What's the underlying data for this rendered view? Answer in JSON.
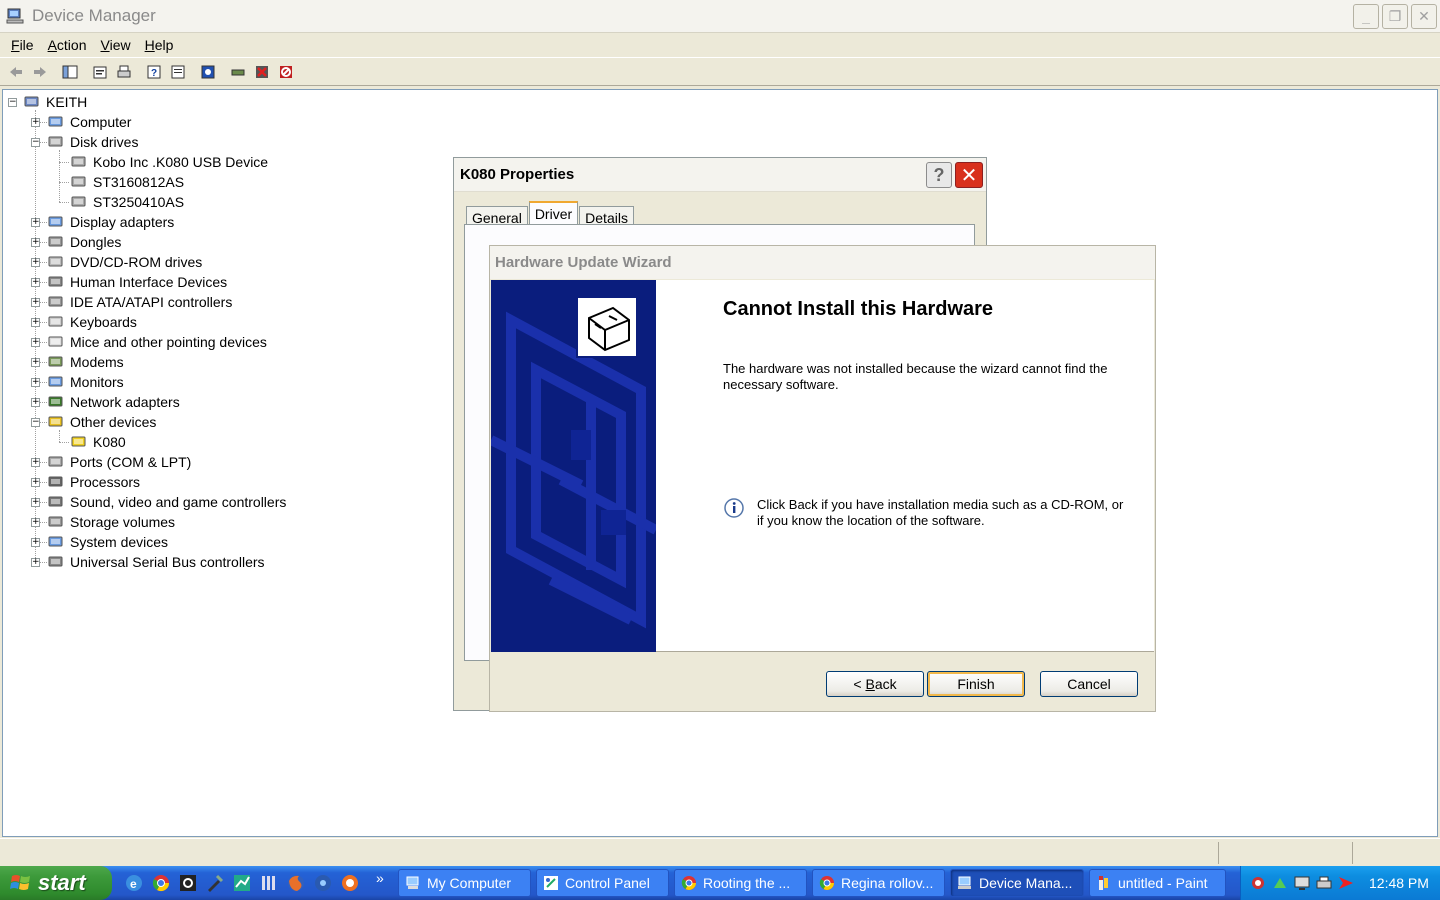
{
  "window": {
    "title": "Device Manager"
  },
  "menu": [
    {
      "label": "File",
      "key": "F",
      "rest": "ile"
    },
    {
      "label": "Action",
      "key": "A",
      "rest": "ction"
    },
    {
      "label": "View",
      "key": "V",
      "rest": "iew"
    },
    {
      "label": "Help",
      "key": "H",
      "rest": "elp"
    }
  ],
  "tree": {
    "root": "KEITH",
    "items": [
      {
        "label": "Computer",
        "expanded": false
      },
      {
        "label": "Disk drives",
        "expanded": true,
        "children": [
          "Kobo Inc .K080 USB Device",
          "ST3160812AS",
          "ST3250410AS"
        ]
      },
      {
        "label": "Display adapters",
        "expanded": false
      },
      {
        "label": "Dongles",
        "expanded": false
      },
      {
        "label": "DVD/CD-ROM drives",
        "expanded": false
      },
      {
        "label": "Human Interface Devices",
        "expanded": false
      },
      {
        "label": "IDE ATA/ATAPI controllers",
        "expanded": false
      },
      {
        "label": "Keyboards",
        "expanded": false
      },
      {
        "label": "Mice and other pointing devices",
        "expanded": false
      },
      {
        "label": "Modems",
        "expanded": false
      },
      {
        "label": "Monitors",
        "expanded": false
      },
      {
        "label": "Network adapters",
        "expanded": false
      },
      {
        "label": "Other devices",
        "expanded": true,
        "children": [
          "K080"
        ]
      },
      {
        "label": "Ports (COM & LPT)",
        "expanded": false
      },
      {
        "label": "Processors",
        "expanded": false
      },
      {
        "label": "Sound, video and game controllers",
        "expanded": false
      },
      {
        "label": "Storage volumes",
        "expanded": false
      },
      {
        "label": "System devices",
        "expanded": false
      },
      {
        "label": "Universal Serial Bus controllers",
        "expanded": false
      }
    ]
  },
  "properties": {
    "title": "K080 Properties",
    "help": "?",
    "tabs": [
      "General",
      "Driver",
      "Details"
    ],
    "active_tab": "Driver"
  },
  "wizard": {
    "title": "Hardware Update Wizard",
    "heading": "Cannot Install this Hardware",
    "message": "The hardware was not installed because the wizard cannot find the necessary software.",
    "info": "Click Back if you have installation media such as a CD-ROM, or if you know the location of the software.",
    "back_pre": "< ",
    "back_key": "B",
    "back_rest": "ack",
    "finish": "Finish",
    "cancel": "Cancel"
  },
  "taskbar": {
    "start": "start",
    "more": "»",
    "tasks": [
      "My Computer",
      "Control Panel",
      "Rooting the ...",
      "Regina rollov...",
      "Device Mana...",
      "untitled - Paint"
    ],
    "active_task": "Device Mana...",
    "clock": "12:48 PM"
  },
  "colors": {
    "wizard_side": "#0a1d7d",
    "taskbar": "#2457c9",
    "start": "#3d9a3b",
    "close": "#d8301c"
  }
}
